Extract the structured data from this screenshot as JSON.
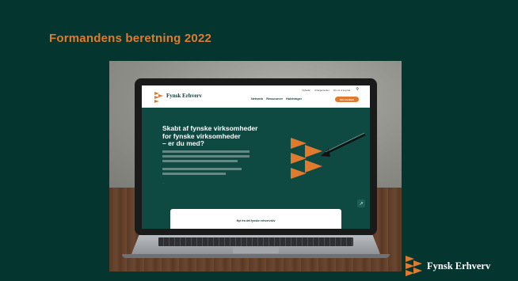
{
  "slide": {
    "title": "Formandens beretning 2022",
    "background": "#05352f",
    "accent": "#e07a2f"
  },
  "website": {
    "logo_text": "Fynsk Erhverv",
    "utility_nav": [
      "Nyheder",
      "Arrangementer",
      "Om os"
    ],
    "login_label": "Log ind",
    "main_nav": [
      "Netværk",
      "Ressourcer",
      "Holdninger"
    ],
    "cta_label": "Bliv medlem",
    "hero_lines": [
      "Skabt af fynske virksomheder",
      "for fynske virksomheder",
      "– er du med?"
    ],
    "card_title": "Nyt fra det fynske erhvervsliv",
    "icons": {
      "search": "search-icon",
      "user": "user-icon",
      "scroll": "arrow-up-right-icon"
    }
  },
  "footer": {
    "brand_text": "Fynsk Erhverv"
  }
}
